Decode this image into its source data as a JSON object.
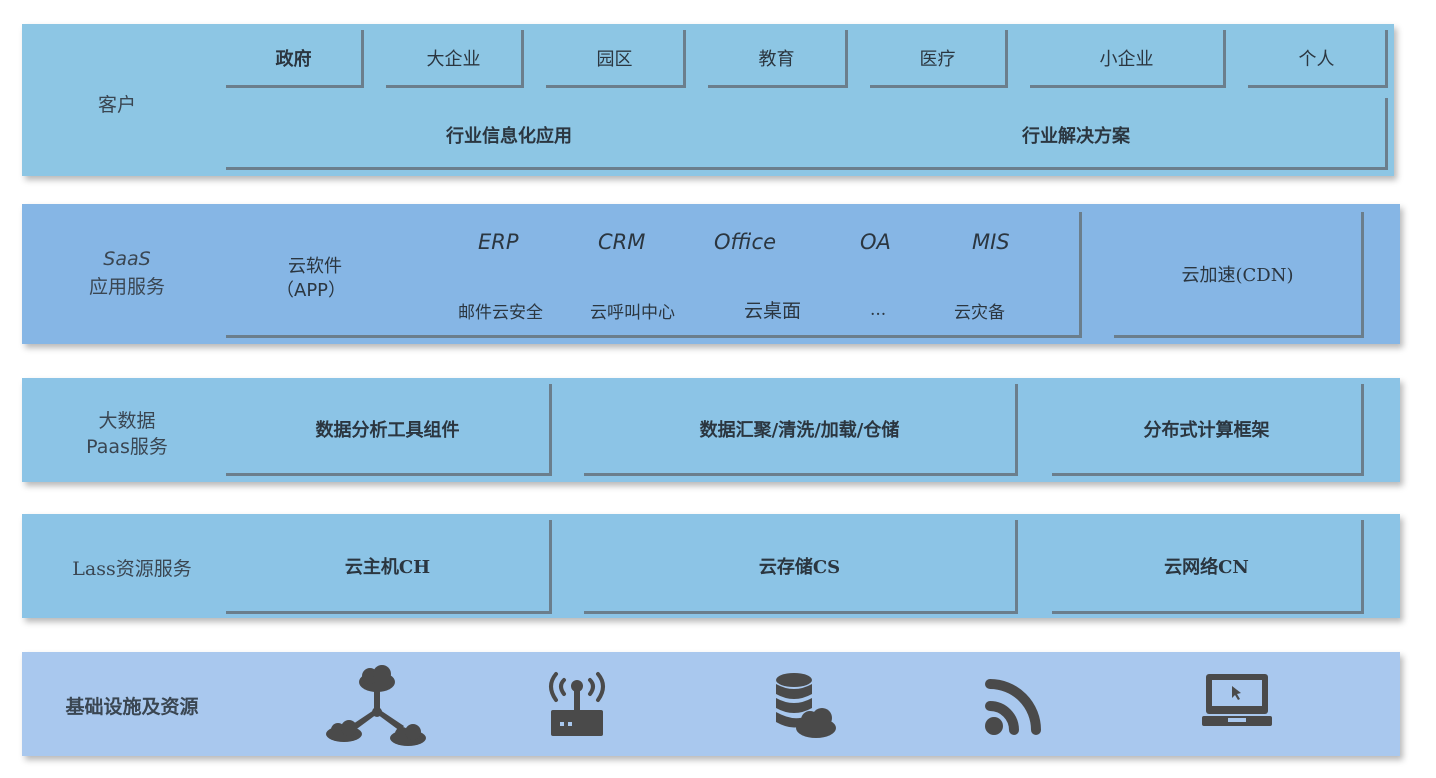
{
  "customer": {
    "label": "客户",
    "segments": [
      "政府",
      "大企业",
      "园区",
      "教育",
      "医疗",
      "小企业",
      "个人"
    ],
    "apps": [
      "行业信息化应用",
      "行业解决方案"
    ]
  },
  "saas": {
    "label_line1": "SaaS",
    "label_line2": "应用服务",
    "cloud_software_line1": "云软件",
    "cloud_software_line2": "（APP）",
    "row1": [
      "ERP",
      "CRM",
      "Office",
      "OA",
      "MIS"
    ],
    "row2": [
      "邮件云安全",
      "云呼叫中心",
      "云桌面",
      "...",
      "云灾备"
    ],
    "cdn": "云加速(CDN)"
  },
  "paas": {
    "label_line1": "大数据",
    "label_line2": "Paas服务",
    "items": [
      "数据分析工具组件",
      "数据汇聚/清洗/加载/仓储",
      "分布式计算框架"
    ]
  },
  "iaas": {
    "label": "Lass资源服务",
    "items": [
      "云主机CH",
      "云存储CS",
      "云网络CN"
    ]
  },
  "infra": {
    "label": "基础设施及资源",
    "icons": [
      "cloud-network-icon",
      "router-icon",
      "database-cloud-icon",
      "rss-icon",
      "laptop-icon"
    ]
  },
  "colors": {
    "customer_bg": "#8dc6e4",
    "saas_bg": "#86b6e5",
    "paas_bg": "#8cc4e6",
    "iaas_bg": "#8cc4e6",
    "infra_bg": "#a9c8ee",
    "icon": "#4a4a4a"
  }
}
